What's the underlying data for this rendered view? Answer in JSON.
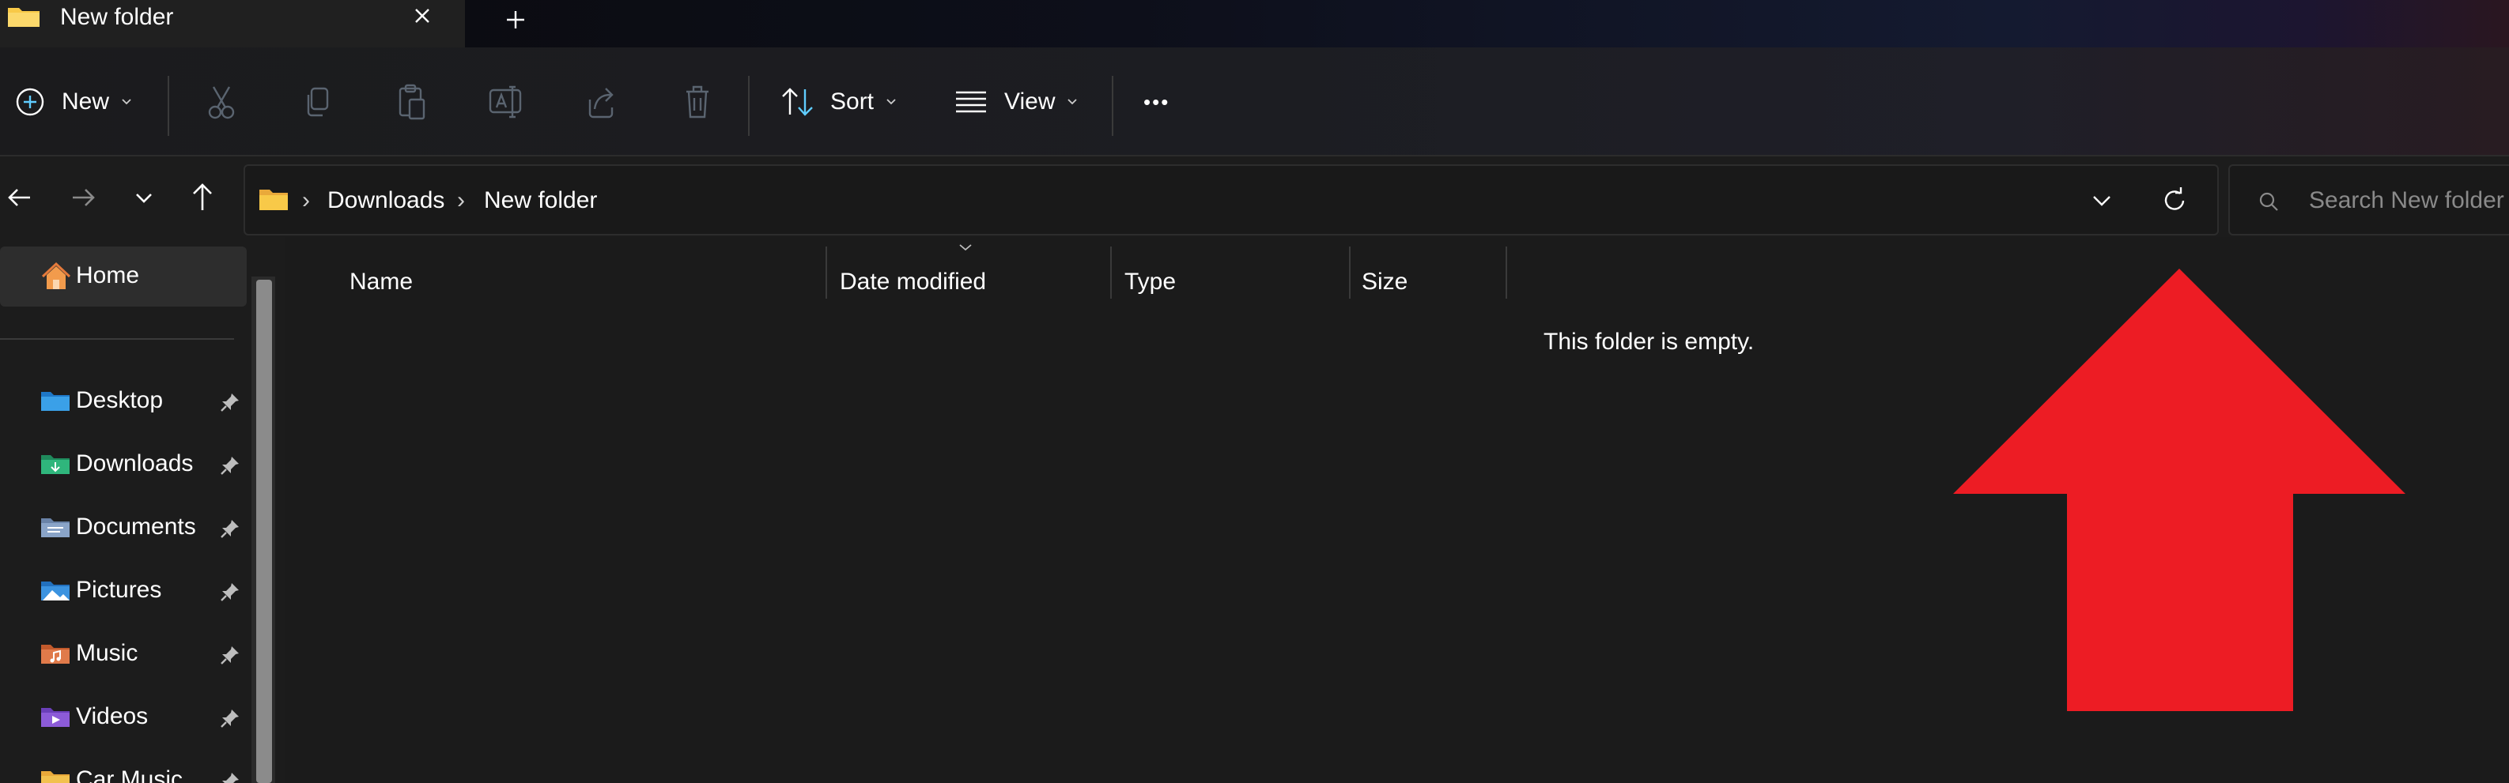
{
  "window": {
    "tab_title": "New folder",
    "close_symbol": "✕",
    "new_tab_symbol": "+"
  },
  "command_bar": {
    "new_label": "New",
    "sort_label": "Sort",
    "view_label": "View",
    "more_label": "•••",
    "icons": [
      "plus-circle-icon",
      "cut-icon",
      "copy-icon",
      "paste-icon",
      "rename-icon",
      "share-icon",
      "delete-icon",
      "sort-icon",
      "view-icon",
      "more-icon"
    ]
  },
  "address": {
    "crumbs": [
      "Downloads",
      "New folder"
    ],
    "separator": "›",
    "search_placeholder": "Search New folder"
  },
  "sidebar": {
    "home": "Home",
    "items": [
      {
        "label": "Desktop",
        "icon": "desktop-folder-icon",
        "color": "#3aa0e8"
      },
      {
        "label": "Downloads",
        "icon": "downloads-folder-icon",
        "color": "#2fb67c"
      },
      {
        "label": "Documents",
        "icon": "documents-folder-icon",
        "color": "#8aa4c8"
      },
      {
        "label": "Pictures",
        "icon": "pictures-folder-icon",
        "color": "#3b93e0"
      },
      {
        "label": "Music",
        "icon": "music-folder-icon",
        "color": "#e07a4a"
      },
      {
        "label": "Videos",
        "icon": "videos-folder-icon",
        "color": "#8c5bd8"
      },
      {
        "label": "Car Music",
        "icon": "folder-icon",
        "color": "#f2c14e"
      }
    ]
  },
  "list": {
    "columns": [
      "Name",
      "Date modified",
      "Type",
      "Size"
    ],
    "empty_message": "This folder is empty."
  },
  "colors": {
    "folder_yellow": "#f8c948",
    "annotation_arrow": "#ed1c24",
    "background": "#1c1c1c"
  }
}
